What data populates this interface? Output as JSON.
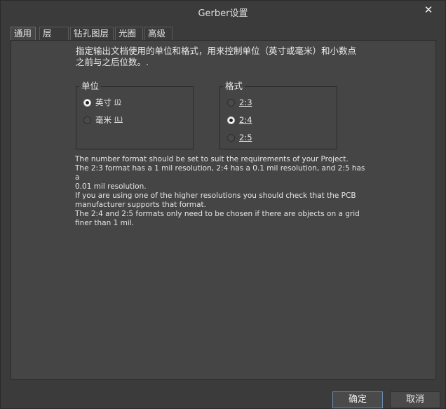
{
  "window": {
    "title": "Gerber设置",
    "close_glyph": "✕"
  },
  "tabs": [
    {
      "label": "通用",
      "active": true
    },
    {
      "label": "层",
      "active": false
    },
    {
      "label": "钻孔图层",
      "active": false
    },
    {
      "label": "光圈",
      "active": false
    },
    {
      "label": "高级",
      "active": false
    }
  ],
  "intro": {
    "line1": "指定输出文档使用的单位和格式，用来控制单位（英寸或毫米）和小数点",
    "line2": "之前与之后位数。."
  },
  "units": {
    "title": "单位",
    "options": [
      {
        "label": "英寸",
        "accel": "(I)",
        "checked": true
      },
      {
        "label": "毫米",
        "accel": "(L)",
        "checked": false
      }
    ]
  },
  "format": {
    "title": "格式",
    "options": [
      {
        "label": "2:3",
        "checked": false
      },
      {
        "label": "2:4",
        "checked": true
      },
      {
        "label": "2:5",
        "checked": false
      }
    ]
  },
  "notes": {
    "l1": "The number format should be set to suit the requirements of your Project.",
    "l2": "The 2:3 format has a 1 mil resolution, 2:4 has a 0.1 mil resolution, and 2:5 has a",
    "l3": "0.01 mil resolution.",
    "l4": "If you are using one of the higher resolutions you should check that the PCB",
    "l5": "manufacturer supports that format.",
    "l6": "The 2:4 and 2:5 formats only need to be chosen if there are objects on a grid",
    "l7": "finer than 1 mil."
  },
  "buttons": {
    "ok": "确定",
    "cancel": "取消"
  },
  "colors": {
    "background": "#3b3b3b",
    "panel": "#454545",
    "accent_border": "#6c8fb0"
  }
}
